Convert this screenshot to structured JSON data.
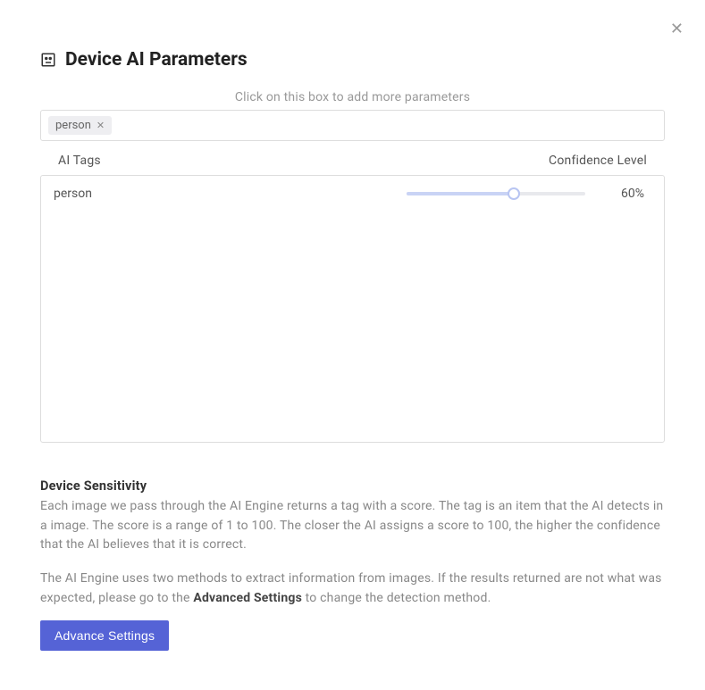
{
  "header": {
    "title": "Device AI Parameters"
  },
  "tagbox": {
    "helper_text": "Click on this box to add more parameters",
    "tags": [
      {
        "label": "person"
      }
    ]
  },
  "columns": {
    "left": "AI Tags",
    "right": "Confidence Level"
  },
  "rows": [
    {
      "label": "person",
      "value": 60,
      "display": "60%"
    }
  ],
  "sensitivity": {
    "title": "Device Sensitivity",
    "p1": "Each image we pass through the AI Engine returns a tag with a score. The tag is an item that the AI detects in a image. The score is a range of 1 to 100. The closer the AI assigns a score to 100, the higher the confidence that the AI believes that it is correct.",
    "p2_pre": "The AI Engine uses two methods to extract information from images. If the results returned are not what was expected, please go to the ",
    "p2_bold": "Advanced Settings",
    "p2_post": " to change the detection method."
  },
  "buttons": {
    "advance": "Advance Settings"
  }
}
